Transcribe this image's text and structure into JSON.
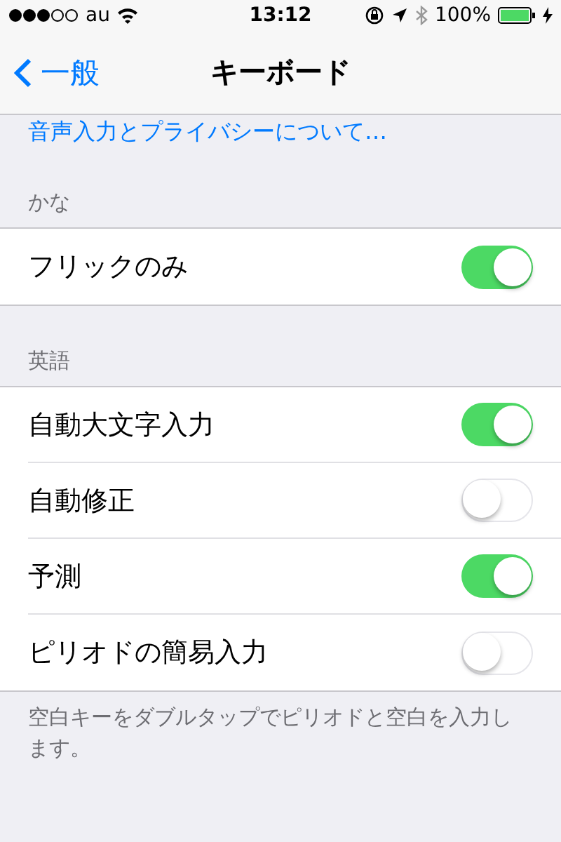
{
  "status_bar": {
    "carrier": "au",
    "time": "13:12",
    "battery": "100%"
  },
  "nav": {
    "back": "一般",
    "title": "キーボード"
  },
  "link": "音声入力とプライバシーについて…",
  "sections": [
    {
      "header": "かな",
      "rows": [
        {
          "label": "フリックのみ",
          "on": true
        }
      ]
    },
    {
      "header": "英語",
      "rows": [
        {
          "label": "自動大文字入力",
          "on": true
        },
        {
          "label": "自動修正",
          "on": false
        },
        {
          "label": "予測",
          "on": true
        },
        {
          "label": "ピリオドの簡易入力",
          "on": false
        }
      ],
      "footer": "空白キーをダブルタップでピリオドと空白を入力します。"
    }
  ]
}
